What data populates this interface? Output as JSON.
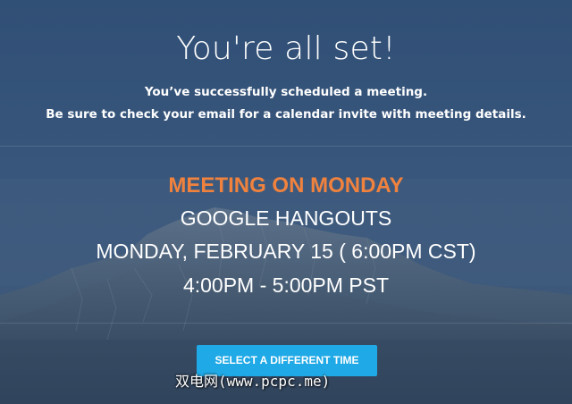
{
  "confirmation": {
    "headline": "You're all set!",
    "message_line1": "You’ve successfully scheduled a meeting.",
    "message_line2": "Be sure to check your email for a calendar invite with meeting details."
  },
  "meeting": {
    "title": "MEETING ON MONDAY",
    "provider": "GOOGLE HANGOUTS",
    "date_time": "MONDAY, FEBRUARY 15 ( 6:00PM CST)",
    "time_range": "4:00PM - 5:00PM PST"
  },
  "actions": {
    "select_different_time_label": "SELECT A DIFFERENT TIME"
  },
  "watermark": {
    "text": "双电网(www.pcpc.me)"
  },
  "colors": {
    "accent_orange": "#f0823e",
    "button_blue": "#1fa9e6",
    "background_blue": "#3f5878"
  }
}
